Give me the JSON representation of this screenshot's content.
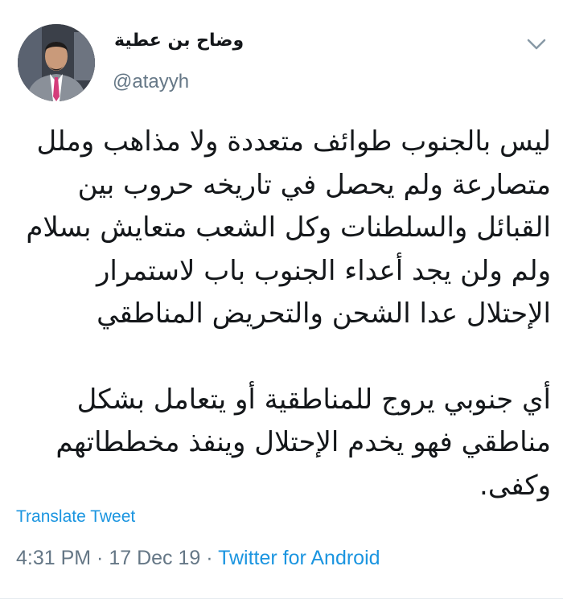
{
  "tweet": {
    "author": {
      "display_name": "وضاح بن عطية",
      "handle": "@atayyh"
    },
    "body": {
      "paragraph1_lines": [
        "ليس بالجنوب طوائف متعددة ولا مذاهب وملل",
        "متصارعة ولم يحصل في تاريخه حروب بين",
        "القبائل والسلطنات وكل الشعب متعايش بسلام",
        "ولم ولن يجد أعداء الجنوب باب لاستمرار",
        "الإحتلال عدا الشحن والتحريض المناطقي"
      ],
      "paragraph2_lines": [
        "أي جنوبي يروج للمناطقية أو يتعامل بشكل",
        "مناطقي فهو يخدم الإحتلال وينفذ مخططاتهم",
        "وكفى."
      ]
    },
    "translate_label": "Translate Tweet",
    "time": "4:31 PM",
    "separator1": " · ",
    "date": "17 Dec 19",
    "separator2": " · ",
    "source": "Twitter for Android"
  },
  "icons": {
    "menu": "chevron-down-icon",
    "avatar": "avatar-photo"
  },
  "colors": {
    "link": "#1b95e0",
    "secondary_text": "#657786",
    "primary_text": "#14171a"
  }
}
